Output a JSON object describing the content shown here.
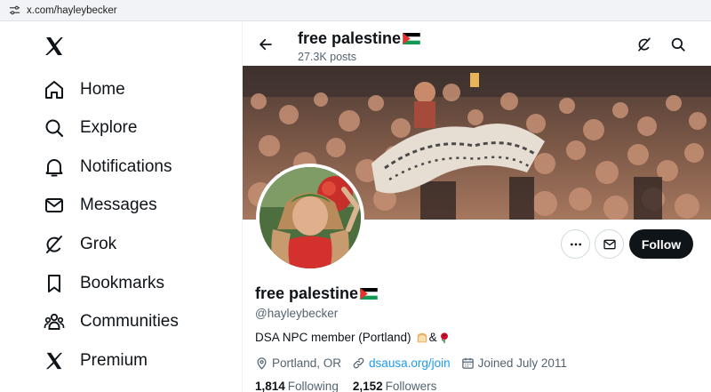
{
  "browser": {
    "url": "x.com/hayleybecker",
    "site_info_icon": "site-settings-icon"
  },
  "sidebar": {
    "logo": "x-logo-icon",
    "items": [
      {
        "label": "Home",
        "icon": "home-icon"
      },
      {
        "label": "Explore",
        "icon": "search-icon"
      },
      {
        "label": "Notifications",
        "icon": "bell-icon"
      },
      {
        "label": "Messages",
        "icon": "envelope-icon"
      },
      {
        "label": "Grok",
        "icon": "grok-icon"
      },
      {
        "label": "Bookmarks",
        "icon": "bookmark-icon"
      },
      {
        "label": "Communities",
        "icon": "communities-icon"
      },
      {
        "label": "Premium",
        "icon": "x-premium-icon"
      }
    ]
  },
  "header": {
    "title": "free palestine",
    "posts_count": "27.3K posts",
    "back_icon": "back-arrow-icon",
    "grok_icon": "grok-icon",
    "search_icon": "search-icon"
  },
  "profile": {
    "display_name": "free palestine",
    "handle": "@hayleybecker",
    "bio_text": "DSA NPC member (Portland)",
    "bio_connector": "&",
    "location": "Portland, OR",
    "website": "dsausa.org/join",
    "joined": "Joined July 2011",
    "following_count": "1,814",
    "following_label": "Following",
    "followers_count": "2,152",
    "followers_label": "Followers",
    "follow_button": "Follow",
    "more_icon": "more-options-icon",
    "message_icon": "envelope-icon"
  },
  "colors": {
    "text": "#0f1419",
    "secondary": "#536471",
    "link": "#1d9bf0",
    "follow_bg": "#0f1419"
  }
}
